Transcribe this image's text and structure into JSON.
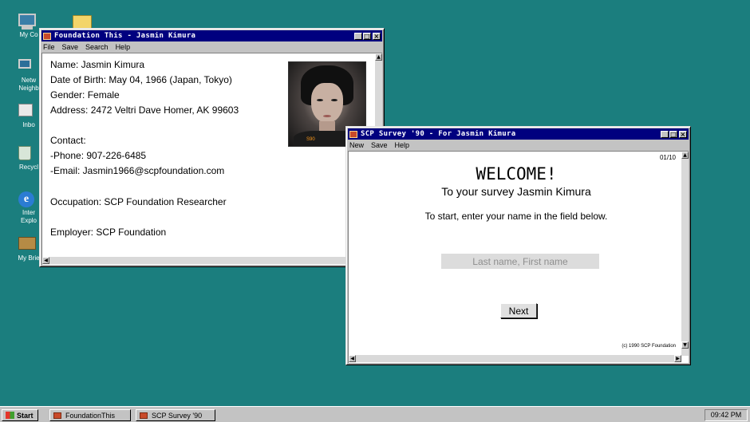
{
  "desktop": {
    "corner_text": "",
    "icons": [
      {
        "label": "My Co",
        "icon": "computer-icon"
      },
      {
        "label": "",
        "icon": "folder-icon"
      },
      {
        "label": "Netw\nNeighb",
        "icon": "network-icon"
      },
      {
        "label": "Inbo",
        "icon": "inbox-icon"
      },
      {
        "label": "Recycl",
        "icon": "recycle-bin-icon"
      },
      {
        "label": "Inter\nExplo",
        "icon": "internet-explorer-icon"
      },
      {
        "label": "My Brie",
        "icon": "briefcase-icon"
      }
    ]
  },
  "profile_window": {
    "title": "Foundation This - Jasmin Kimura",
    "menu": [
      "File",
      "Save",
      "Search",
      "Help"
    ],
    "lines": [
      "Name: Jasmin Kimura",
      "Date of Birth: May 04, 1966 (Japan, Tokyo)",
      "Gender: Female",
      "Address: 2472 Veltri Dave Homer, AK 99603",
      "Contact:",
      "-Phone: 907-226-6485",
      "-Email: Jasmin1966@scpfoundation.com",
      "Occupation: SCP Foundation Researcher",
      "Employer: SCP Foundation"
    ],
    "photo_tag": "S90"
  },
  "survey_window": {
    "title": "SCP Survey '90 - For Jasmin Kimura",
    "menu": [
      "New",
      "Save",
      "Help"
    ],
    "counter": "01/10",
    "heading": "WELCOME!",
    "subtitle": "To your survey Jasmin Kimura",
    "instruction": "To start, enter your name in the field below.",
    "name_field": {
      "value": "",
      "placeholder": "Last name, First name"
    },
    "next_label": "Next",
    "copyright": "(c) 1990 SCP Foundation"
  },
  "taskbar": {
    "start_label": "Start",
    "tasks": [
      "FoundationThis",
      "SCP Survey '90"
    ],
    "clock": "09:42 PM"
  },
  "colors": {
    "desktop": "#1b7e7e",
    "titlebar": "#00007f",
    "chrome": "#c3c3c3"
  }
}
